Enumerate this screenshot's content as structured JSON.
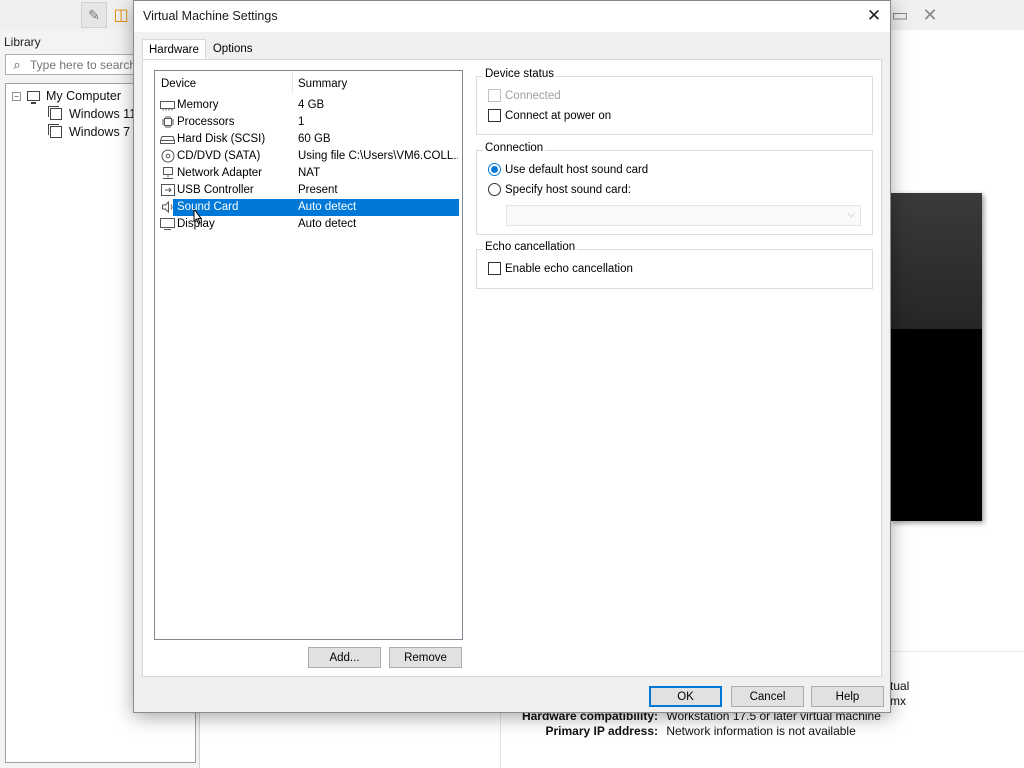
{
  "background_app": {
    "library_title": "Library",
    "search_placeholder": "Type here to search",
    "tree": {
      "root": "My Computer",
      "expander": "−",
      "items": [
        "Windows 11",
        "Windows 7 x64"
      ]
    },
    "details": {
      "line1_tail": "tual",
      "line2_tail": "mx",
      "hardware_compat_label": "Hardware compatibility:",
      "hardware_compat_value": "Workstation 17.5 or later virtual machine",
      "ip_label": "Primary IP address:",
      "ip_value": "Network information is not available"
    }
  },
  "dialog": {
    "title": "Virtual Machine Settings",
    "close_glyph": "✕",
    "tabs": [
      {
        "label": "Hardware",
        "active": true
      },
      {
        "label": "Options",
        "active": false
      }
    ],
    "device_list": {
      "col_device": "Device",
      "col_summary": "Summary",
      "rows": [
        {
          "name": "Memory",
          "summary": "4 GB",
          "icon": "memory-icon"
        },
        {
          "name": "Processors",
          "summary": "1",
          "icon": "processor-icon"
        },
        {
          "name": "Hard Disk (SCSI)",
          "summary": "60 GB",
          "icon": "hard-disk-icon"
        },
        {
          "name": "CD/DVD (SATA)",
          "summary": "Using file C:\\Users\\VM6.COLL...",
          "icon": "cd-dvd-icon"
        },
        {
          "name": "Network Adapter",
          "summary": "NAT",
          "icon": "network-adapter-icon"
        },
        {
          "name": "USB Controller",
          "summary": "Present",
          "icon": "usb-icon"
        },
        {
          "name": "Sound Card",
          "summary": "Auto detect",
          "icon": "speaker-icon",
          "selected": true
        },
        {
          "name": "Display",
          "summary": "Auto detect",
          "icon": "display-icon"
        }
      ]
    },
    "add_button": "Add...",
    "remove_button": "Remove",
    "device_status": {
      "title": "Device status",
      "connected": "Connected",
      "connect_at_power_on": "Connect at power on"
    },
    "connection": {
      "title": "Connection",
      "use_default": "Use default host sound card",
      "specify": "Specify host sound card:",
      "selected": "use_default",
      "host_card_value": ""
    },
    "echo": {
      "title": "Echo cancellation",
      "enable": "Enable echo cancellation"
    },
    "ok_button": "OK",
    "cancel_button": "Cancel",
    "help_button": "Help"
  },
  "colors": {
    "selection": "#0078d7",
    "dialog_bg": "#f0f0f0"
  }
}
